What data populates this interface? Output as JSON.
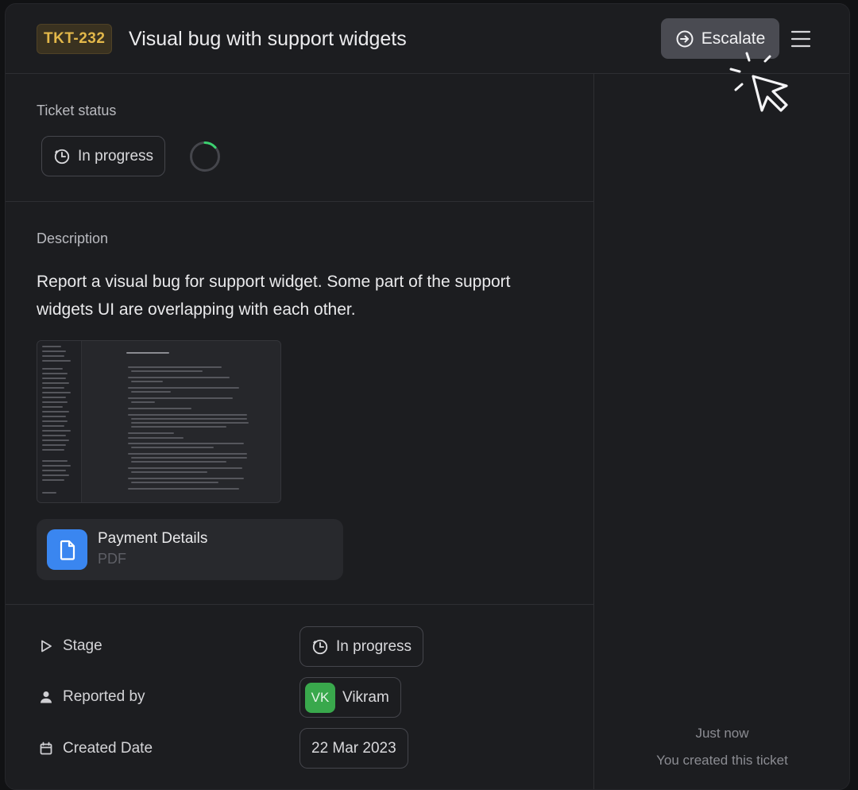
{
  "header": {
    "ticket_id": "TKT-232",
    "title": "Visual bug with support widgets",
    "escalate_label": "Escalate",
    "accent_color": "#e3b84a"
  },
  "status": {
    "label": "Ticket status",
    "value": "In progress",
    "icon": "clock-icon"
  },
  "description": {
    "label": "Description",
    "text": "Report a visual bug for support widget. Some part of the support widgets UI are overlapping with each other.",
    "attachment": {
      "name": "Payment Details",
      "type": "PDF",
      "icon": "file-icon"
    }
  },
  "properties": {
    "stage": {
      "label": "Stage",
      "value": "In progress",
      "icon": "play-icon"
    },
    "reported_by": {
      "label": "Reported by",
      "avatar_initials": "VK",
      "name": "Vikram",
      "icon": "person-icon"
    },
    "created_date": {
      "label": "Created Date",
      "value": "22 Mar 2023",
      "icon": "calendar-icon"
    }
  },
  "activity": {
    "time": "Just now",
    "message": "You created this ticket"
  }
}
